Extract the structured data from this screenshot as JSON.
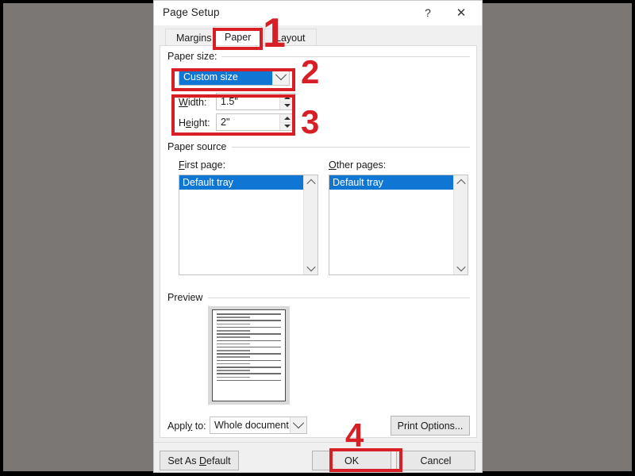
{
  "window": {
    "title": "Page Setup",
    "help_icon": "?",
    "close_icon": "✕"
  },
  "tabs": [
    {
      "label": "Margins",
      "active": false
    },
    {
      "label": "Paper",
      "active": true
    },
    {
      "label": "Layout",
      "active": false
    }
  ],
  "paper_size": {
    "group_label": "Paper size:",
    "size_value": "Custom size",
    "width_label": "Width:",
    "width_value": "1.5\"",
    "height_label": "Height:",
    "height_value": "2\""
  },
  "paper_source": {
    "group_label": "Paper source",
    "first_page_label": "First page:",
    "first_page_items": [
      "Default tray"
    ],
    "other_pages_label": "Other pages:",
    "other_pages_items": [
      "Default tray"
    ]
  },
  "preview": {
    "group_label": "Preview"
  },
  "apply": {
    "label": "Apply to:",
    "value": "Whole document",
    "print_options_label": "Print Options..."
  },
  "footer": {
    "set_as_default": "Set As Default",
    "ok": "OK",
    "cancel": "Cancel"
  },
  "annotations": {
    "accent_color": "#d91f26",
    "step1": "1",
    "step2": "2",
    "step3": "3",
    "step4": "4"
  },
  "colors": {
    "desktop_background": "#7b7775",
    "dialog_background": "#f0f0f0",
    "panel_background": "#ffffff",
    "selection_blue": "#0f76d4",
    "annotation_red": "#d91f26"
  }
}
